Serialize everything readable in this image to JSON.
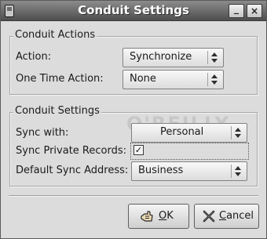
{
  "window": {
    "title": "Conduit Settings",
    "minimize_glyph": "_",
    "close_glyph": "×",
    "title_icon": "pda-icon",
    "watermark": "O'REILLY"
  },
  "conduit_actions": {
    "heading": "Conduit Actions",
    "action_label": "Action:",
    "action_value": "Synchronize",
    "one_time_label": "One Time Action:",
    "one_time_value": "None"
  },
  "conduit_settings": {
    "heading": "Conduit Settings",
    "sync_with_label": "Sync with:",
    "sync_with_value": "Personal",
    "private_label": "Sync Private Records:",
    "private_checked": true,
    "private_glyph": "✓",
    "address_label": "Default Sync Address:",
    "address_value": "Business"
  },
  "buttons": {
    "ok_label": "OK",
    "ok_icon": "ok-hand-icon",
    "cancel_label": "Cancel",
    "cancel_icon": "cancel-x-icon"
  }
}
